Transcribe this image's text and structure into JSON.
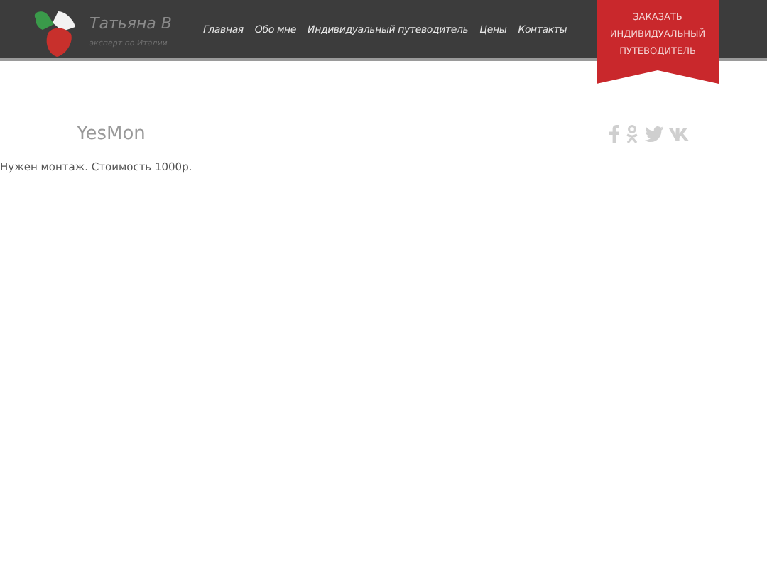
{
  "brand": {
    "name": "Татьяна В",
    "tagline": "эксперт по Италии"
  },
  "nav": [
    {
      "label": "Главная"
    },
    {
      "label": "Обо мне"
    },
    {
      "label": "Индивидуальный путеводитель"
    },
    {
      "label": "Цены"
    },
    {
      "label": "Контакты"
    }
  ],
  "ribbon": {
    "label": "ЗАКАЗАТЬ ИНДИВИДУАЛЬНЫЙ ПУТЕВОДИТЕЛЬ"
  },
  "post": {
    "title": "YesMon",
    "body": "Нужен монтаж. Стоимость 1000р."
  },
  "social": [
    {
      "kind": "facebook"
    },
    {
      "kind": "odnoklassniki"
    },
    {
      "kind": "twitter"
    },
    {
      "kind": "vk"
    }
  ]
}
